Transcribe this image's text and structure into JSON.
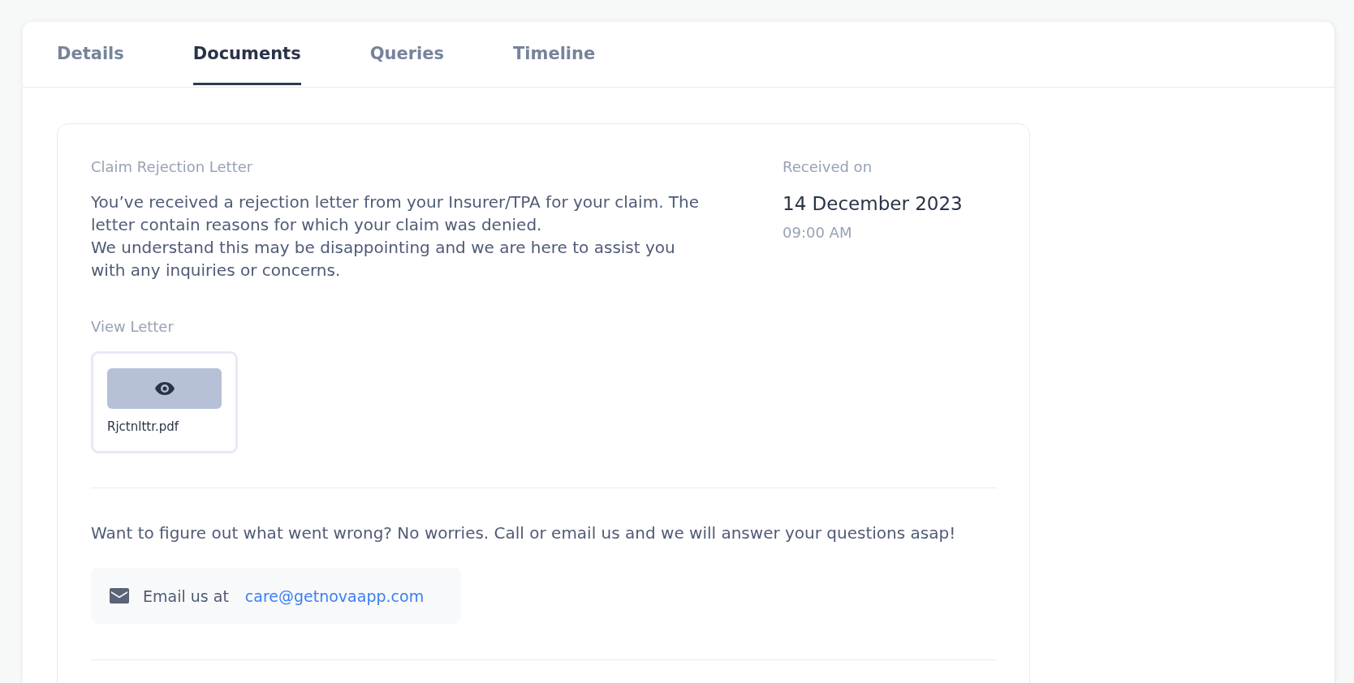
{
  "tabs": [
    {
      "label": "Details",
      "selected": false
    },
    {
      "label": "Documents",
      "selected": true
    },
    {
      "label": "Queries",
      "selected": false
    },
    {
      "label": "Timeline",
      "selected": false
    }
  ],
  "letter": {
    "title": "Claim Rejection Letter",
    "description": [
      "You’ve received a rejection letter from your Insurer/TPA for your claim. The letter contain reasons for which your claim was denied.",
      "We understand this may be disappointing and we are here to assist you with any inquiries or concerns."
    ],
    "received_label": "Received on",
    "received_date": "14 December 2023",
    "received_time": "09:00 AM",
    "view_label": "View Letter",
    "attachments": [
      {
        "file_name": "Rjctnlttr.pdf"
      }
    ]
  },
  "help": {
    "message": "Want to figure out what went wrong? No worries. Call or email us and we will answer your questions asap!",
    "email_label": "Email us at",
    "email": "care@getnovaapp.com"
  }
}
